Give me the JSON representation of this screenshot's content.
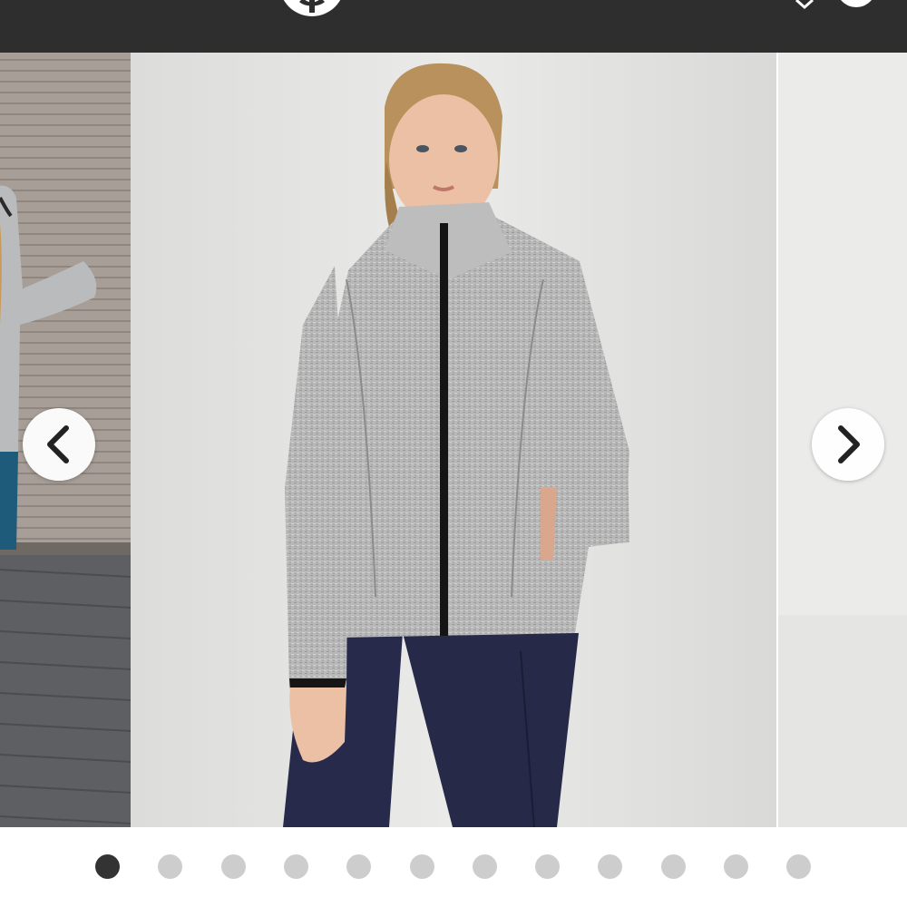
{
  "header": {
    "logo_icon": "brand-logo-icon",
    "right_icons": [
      "chevron-down-icon",
      "account-icon"
    ],
    "background_color": "#2e2e2e"
  },
  "carousel": {
    "slides": [
      {
        "description_icon": "photo-slide-left"
      },
      {
        "description_icon": "photo-slide-main"
      },
      {
        "description_icon": "photo-slide-right"
      }
    ],
    "prev_icon": "chevron-left-icon",
    "next_icon": "chevron-right-icon",
    "total_slides": 12,
    "active_index": 0,
    "active_dot_color": "#333333",
    "inactive_dot_color": "#cdcdcd"
  }
}
